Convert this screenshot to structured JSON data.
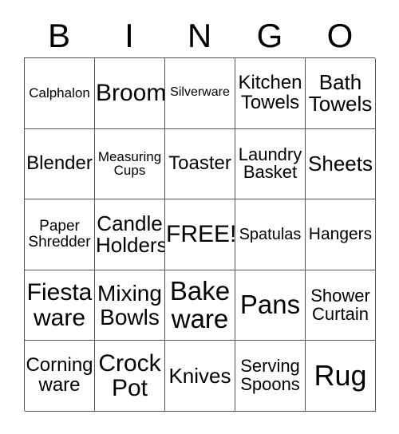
{
  "card": {
    "header_letters": [
      "B",
      "I",
      "N",
      "G",
      "O"
    ],
    "free_space_label": "FREE!",
    "grid_line_color": "#555555",
    "text_color": "#000000",
    "background_color": "#ffffff",
    "rows": [
      [
        {
          "text": "Calphalon",
          "size_class": "fs-17"
        },
        {
          "text": "Broom",
          "size_class": "fs-30"
        },
        {
          "text": "Silverware",
          "size_class": "fs-16"
        },
        {
          "text": "Kitchen\nTowels",
          "size_class": "fs-24"
        },
        {
          "text": "Bath\nTowels",
          "size_class": "fs-26"
        }
      ],
      [
        {
          "text": "Blender",
          "size_class": "fs-24"
        },
        {
          "text": "Measuring\nCups",
          "size_class": "fs-17"
        },
        {
          "text": "Toaster",
          "size_class": "fs-24"
        },
        {
          "text": "Laundry\nBasket",
          "size_class": "fs-22"
        },
        {
          "text": "Sheets",
          "size_class": "fs-26"
        }
      ],
      [
        {
          "text": "Paper\nShredder",
          "size_class": "fs-19"
        },
        {
          "text": "Candle\nHolders",
          "size_class": "fs-26"
        },
        {
          "text": "FREE!",
          "size_class": "fs-30"
        },
        {
          "text": "Spatulas",
          "size_class": "fs-20"
        },
        {
          "text": "Hangers",
          "size_class": "fs-21"
        }
      ],
      [
        {
          "text": "Fiesta\nware",
          "size_class": "fs-30"
        },
        {
          "text": "Mixing\nBowls",
          "size_class": "fs-28"
        },
        {
          "text": "Bake\nware",
          "size_class": "fs-33"
        },
        {
          "text": "Pans",
          "size_class": "fs-33"
        },
        {
          "text": "Shower\nCurtain",
          "size_class": "fs-22"
        }
      ],
      [
        {
          "text": "Corning\nware",
          "size_class": "fs-24"
        },
        {
          "text": "Crock\nPot",
          "size_class": "fs-30"
        },
        {
          "text": "Knives",
          "size_class": "fs-26"
        },
        {
          "text": "Serving\nSpoons",
          "size_class": "fs-22"
        },
        {
          "text": "Rug",
          "size_class": "fs-36"
        }
      ]
    ]
  }
}
